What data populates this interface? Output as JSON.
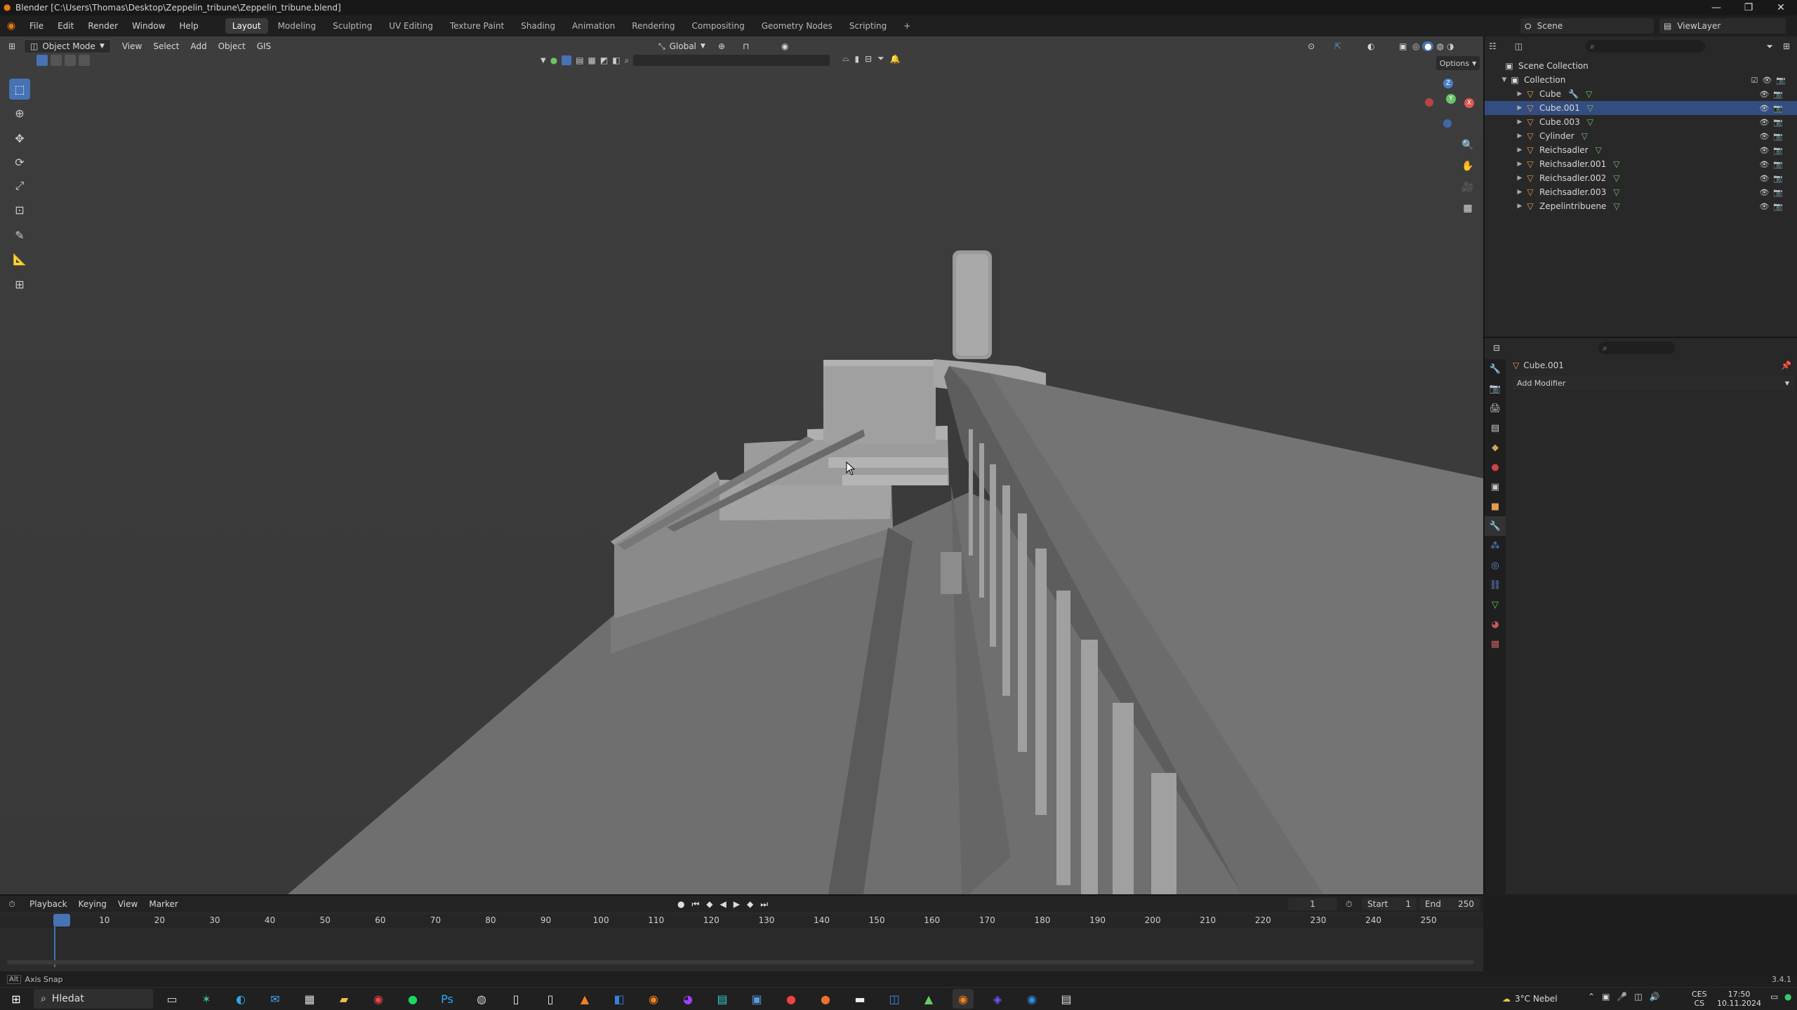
{
  "window": {
    "title": "Blender [C:\\Users\\Thomas\\Desktop\\Zeppelin_tribune\\Zeppelin_tribune.blend]",
    "controls": [
      "—",
      "❐",
      "✕"
    ]
  },
  "menus": [
    "File",
    "Edit",
    "Render",
    "Window",
    "Help"
  ],
  "workspaces": {
    "active": "Layout",
    "tabs": [
      "Layout",
      "Modeling",
      "Sculpting",
      "UV Editing",
      "Texture Paint",
      "Shading",
      "Animation",
      "Rendering",
      "Compositing",
      "Geometry Nodes",
      "Scripting"
    ],
    "add": "+"
  },
  "scene": {
    "label": "Scene",
    "view_layer": "ViewLayer"
  },
  "viewport": {
    "mode": "Object Mode",
    "menus": [
      "View",
      "Select",
      "Add",
      "Object",
      "GIS"
    ],
    "orientation": "Global",
    "options_label": "Options",
    "gizmo_axes": {
      "x": "X",
      "y": "Y",
      "z": "Z"
    }
  },
  "outliner": {
    "scene_collection": "Scene Collection",
    "collection": "Collection",
    "objects": [
      "Cube",
      "Cube.001",
      "Cube.003",
      "Cylinder",
      "Reichsadler",
      "Reichsadler.001",
      "Reichsadler.002",
      "Reichsadler.003",
      "Zepelintribuene"
    ]
  },
  "properties": {
    "object_name": "Cube.001",
    "add_modifier": "Add Modifier"
  },
  "timeline": {
    "menus": [
      "Playback",
      "Keying",
      "View",
      "Marker"
    ],
    "current_frame": "1",
    "start_label": "Start",
    "start": "1",
    "end_label": "End",
    "end": "250",
    "ruler": [
      "1",
      "10",
      "20",
      "30",
      "40",
      "50",
      "60",
      "70",
      "80",
      "90",
      "100",
      "110",
      "120",
      "130",
      "140",
      "150",
      "160",
      "170",
      "180",
      "190",
      "200",
      "210",
      "220",
      "230",
      "240",
      "250"
    ]
  },
  "status": {
    "hint": "Axis Snap",
    "version": "3.4.1"
  },
  "taskbar": {
    "search": "Hledat",
    "weather": "3°C  Nebel",
    "lang_top": "CES",
    "lang_bottom": "CS",
    "time": "17:50",
    "date": "10.11.2024"
  }
}
